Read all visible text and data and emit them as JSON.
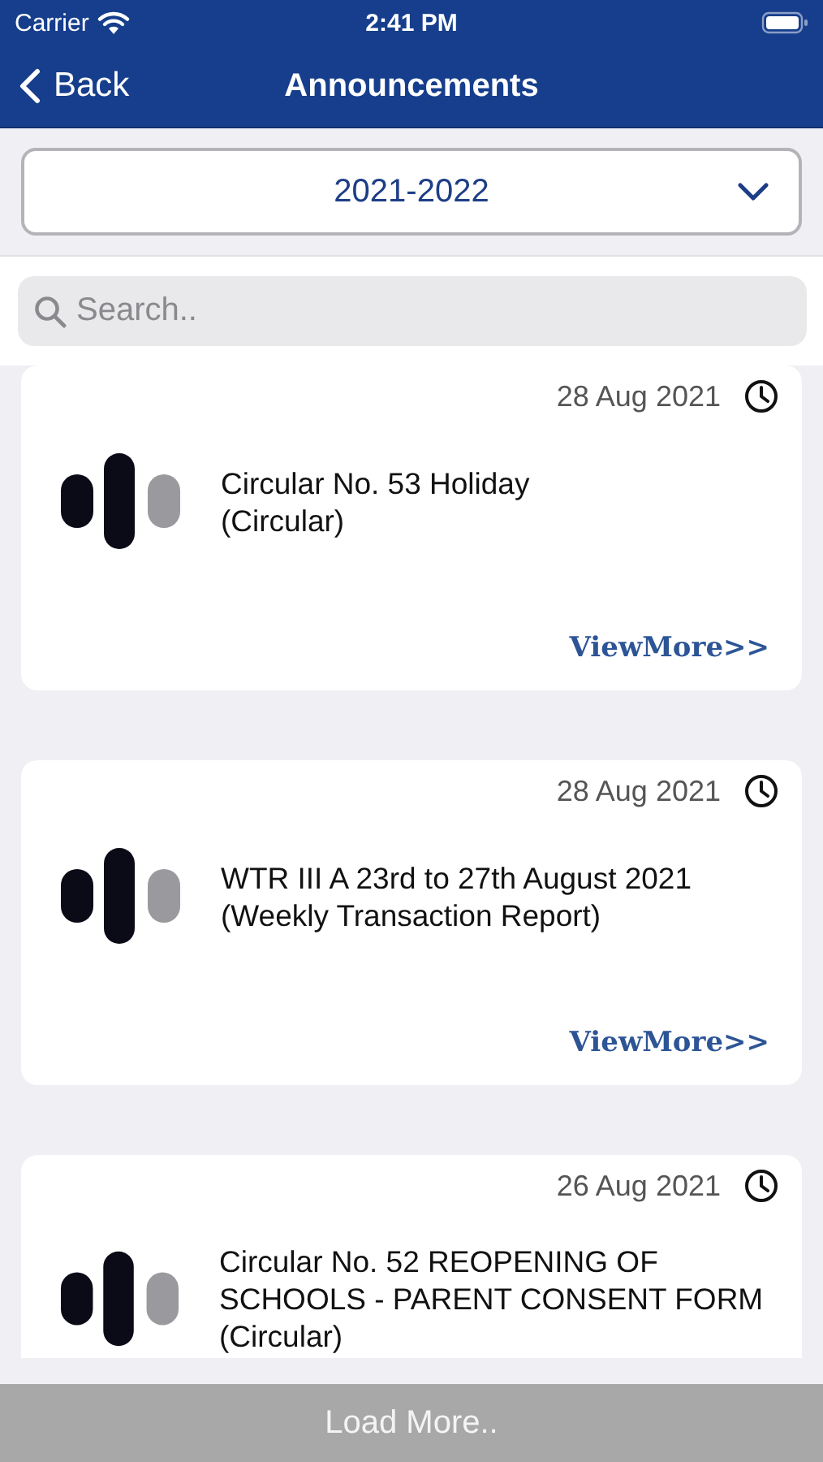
{
  "status_bar": {
    "carrier": "Carrier",
    "time": "2:41 PM"
  },
  "nav": {
    "back": "Back",
    "title": "Announcements"
  },
  "year_picker": {
    "value": "2021-2022"
  },
  "search": {
    "placeholder": "Search.."
  },
  "announcements": [
    {
      "date": "28 Aug 2021",
      "title": "Circular No. 53 Holiday",
      "category": "(Circular)",
      "link": "ViewMore>>"
    },
    {
      "date": "28 Aug 2021",
      "title": "WTR III A 23rd to 27th August 2021",
      "category": "(Weekly Transaction Report)",
      "link": "ViewMore>>"
    },
    {
      "date": "26 Aug 2021",
      "title": "Circular No. 52 REOPENING OF SCHOOLS - PARENT CONSENT FORM",
      "category": "(Circular)"
    }
  ],
  "load_more": "Load More.."
}
